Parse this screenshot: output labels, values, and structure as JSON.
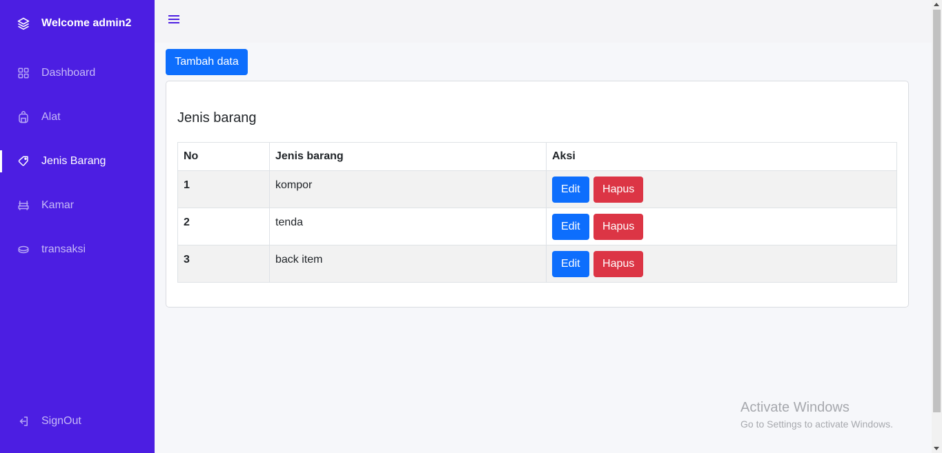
{
  "sidebar": {
    "brand_title": "Welcome admin2",
    "brand_icon": "layers-icon",
    "items": [
      {
        "label": "Dashboard",
        "icon": "grid-icon"
      },
      {
        "label": "Alat",
        "icon": "backpack-icon"
      },
      {
        "label": "Jenis Barang",
        "icon": "tag-icon",
        "active": true
      },
      {
        "label": "Kamar",
        "icon": "bed-icon"
      },
      {
        "label": "transaksi",
        "icon": "coins-icon"
      }
    ],
    "signout_label": "SignOut",
    "signout_icon": "logout-icon",
    "background": "#4c1ee2"
  },
  "topbar": {
    "menu_icon": "hamburger-icon"
  },
  "main": {
    "add_button_label": "Tambah data",
    "card_title": "Jenis barang",
    "table": {
      "headers": [
        "No",
        "Jenis barang",
        "Aksi"
      ],
      "rows": [
        {
          "no": "1",
          "jenis": "kompor"
        },
        {
          "no": "2",
          "jenis": "tenda"
        },
        {
          "no": "3",
          "jenis": "back item"
        }
      ],
      "edit_label": "Edit",
      "delete_label": "Hapus"
    }
  },
  "watermark": {
    "line1": "Activate Windows",
    "line2": "Go to Settings to activate Windows."
  },
  "colors": {
    "primary": "#0d6efd",
    "danger": "#dc3545",
    "sidebar": "#4c1ee2"
  }
}
